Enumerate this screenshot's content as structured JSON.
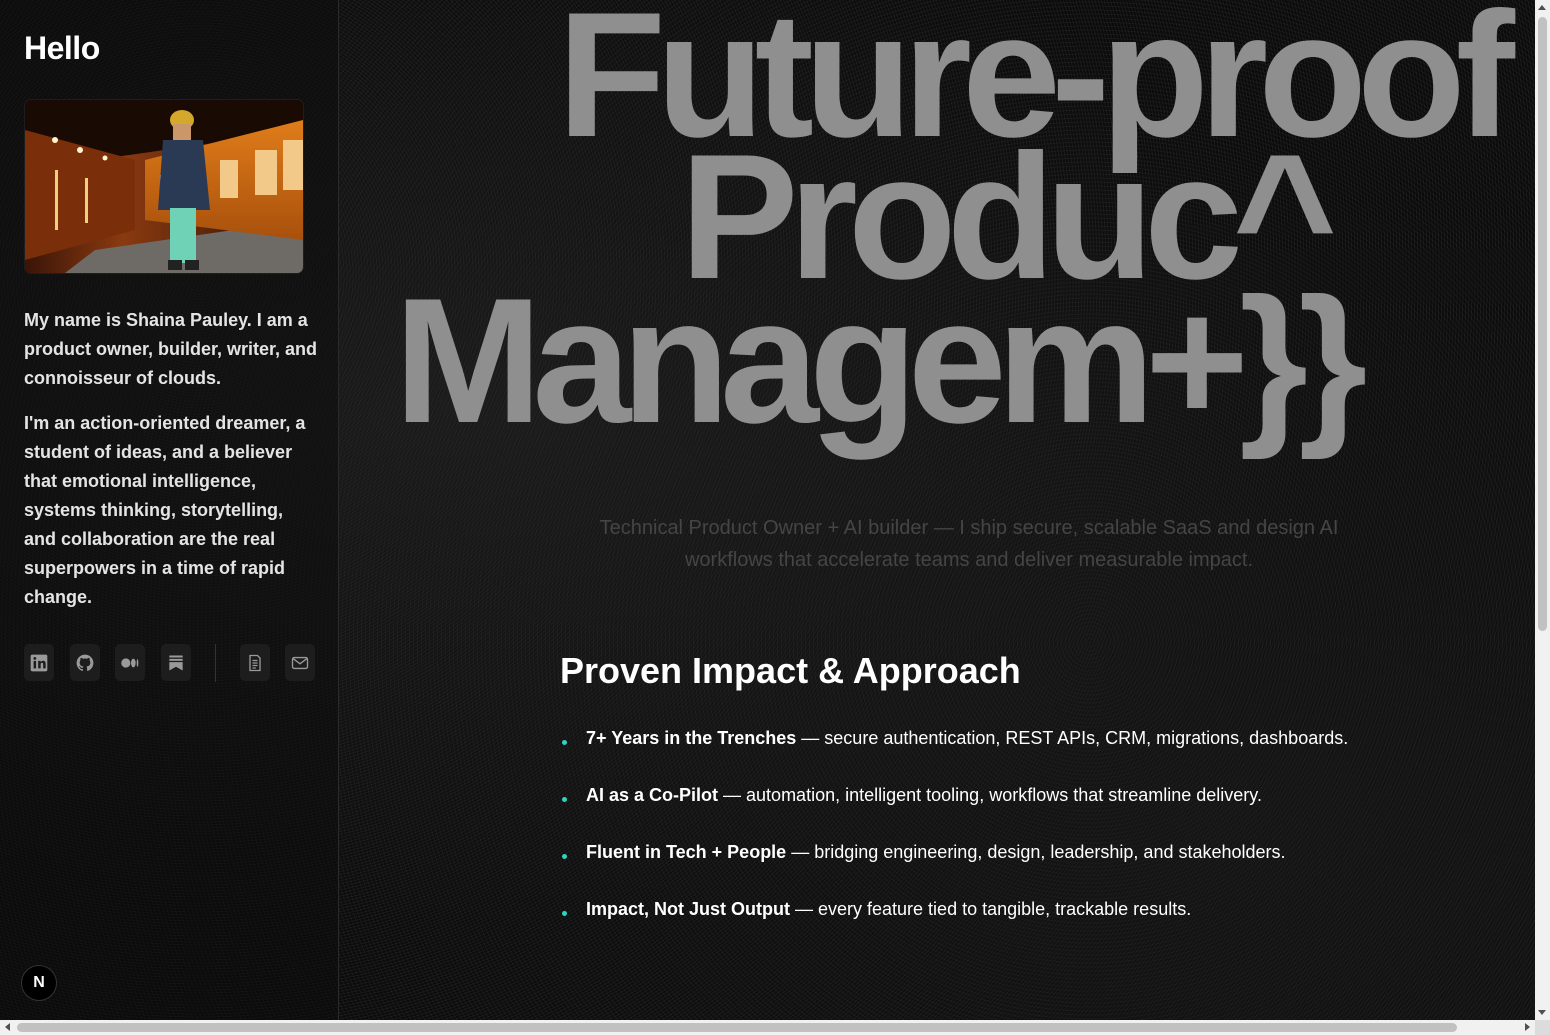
{
  "sidebar": {
    "title": "Hello",
    "bio": [
      "My name is Shaina Pauley. I am a product owner, builder, writer, and connoisseur of clouds.",
      "I'm an action-oriented dreamer, a student of ideas, and a believer that emotional intelligence, systems thinking, storytelling, and collaboration are the real superpowers in a time of rapid change."
    ],
    "social_icons": [
      "linkedin-icon",
      "github-icon",
      "medium-icon",
      "substack-icon"
    ],
    "utility_icons": [
      "resume-icon",
      "mail-icon"
    ],
    "badge_letter": "N"
  },
  "hero": {
    "lines": [
      "Future-proof",
      "Produc^",
      "Managem+}}"
    ]
  },
  "tagline": "Technical Product Owner + AI builder — I ship secure, scalable SaaS and design AI workflows that accelerate teams and deliver measurable impact.",
  "section": {
    "title": "Proven Impact & Approach",
    "items": [
      {
        "bold": "7+ Years in the Trenches",
        "text": " — secure authentication, REST APIs, CRM, migrations, dashboards."
      },
      {
        "bold": "AI as a Co-Pilot",
        "text": " — automation, intelligent tooling, workflows that streamline delivery."
      },
      {
        "bold": "Fluent in Tech + People",
        "text": " — bridging engineering, design, leadership, and stakeholders."
      },
      {
        "bold": "Impact, Not Just Output",
        "text": " — every feature tied to tangible, trackable results."
      }
    ]
  },
  "colors": {
    "accent": "#2dd4bf",
    "hero_text": "#8f8f8f",
    "background": "#0b0b0b"
  }
}
